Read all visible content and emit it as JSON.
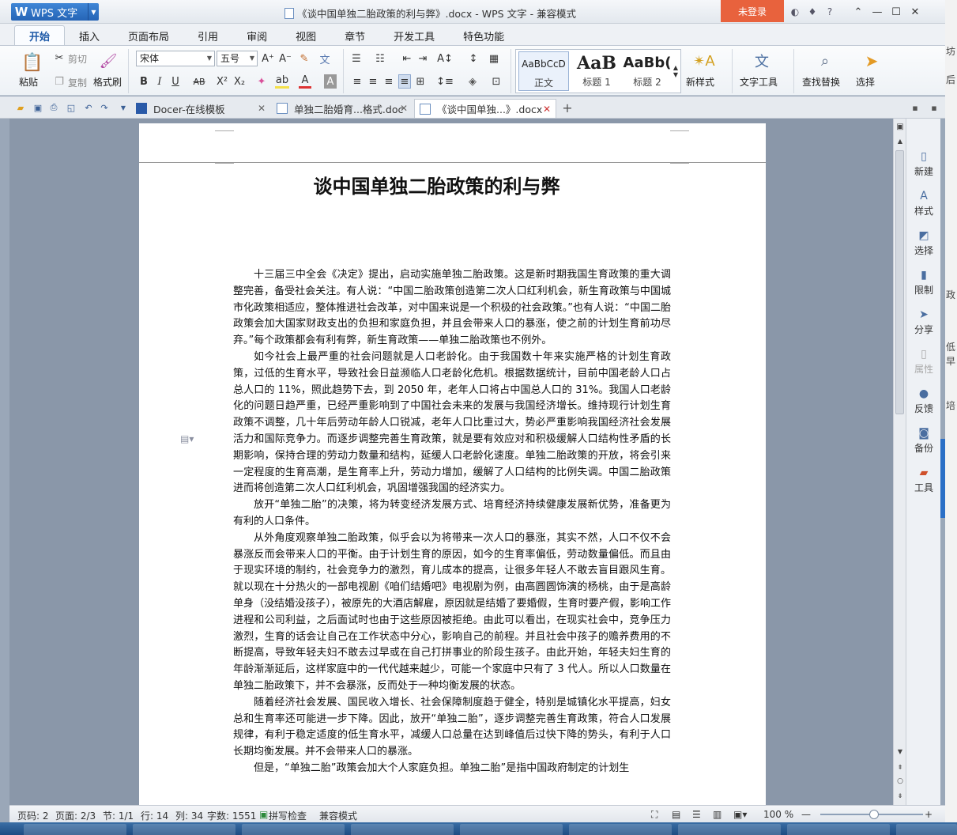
{
  "app": {
    "name": "WPS 文字"
  },
  "window": {
    "title": "《谈中国单独二胎政策的利与弊》.docx - WPS 文字 - 兼容模式",
    "login_label": "未登录"
  },
  "ribbon_tabs": [
    "开始",
    "插入",
    "页面布局",
    "引用",
    "审阅",
    "视图",
    "章节",
    "开发工具",
    "特色功能"
  ],
  "ribbon": {
    "paste": "粘贴",
    "cut": "剪切",
    "copy": "复制",
    "format_painter": "格式刷",
    "font_name": "宋体",
    "font_size": "五号",
    "styles": [
      {
        "sample": "AaBbCcD",
        "name": "正文"
      },
      {
        "sample": "AaB",
        "name": "标题 1"
      },
      {
        "sample": "AaBb(",
        "name": "标题 2"
      }
    ],
    "new_style": "新样式",
    "text_tools": "文字工具",
    "find_replace": "查找替换",
    "select": "选择"
  },
  "doc_tabs": [
    {
      "label": "Docer-在线模板"
    },
    {
      "label": "单独二胎婚育...格式.doc"
    },
    {
      "label": "《谈中国单独...》.docx"
    }
  ],
  "document": {
    "title": "谈中国单独二胎政策的利与弊",
    "paragraphs": [
      "十三届三中全会《决定》提出，启动实施单独二胎政策。这是新时期我国生育政策的重大调整完善，备受社会关注。有人说：“中国二胎政策创造第二次人口红利机会，新生育政策与中国城市化政策相适应，整体推进社会改革，对中国来说是一个积极的社会政策。”也有人说：“中国二胎政策会加大国家财政支出的负担和家庭负担，并且会带来人口的暴涨，使之前的计划生育前功尽弃。”每个政策都会有利有弊，新生育政策——单独二胎政策也不例外。",
      "如今社会上最严重的社会问题就是人口老龄化。由于我国数十年来实施严格的计划生育政策，过低的生育水平，导致社会日益濒临人口老龄化危机。根据数据统计，目前中国老龄人口占总人口的 11%，照此趋势下去，到 2050 年，老年人口将占中国总人口的 31%。我国人口老龄化的问题日趋严重，已经严重影响到了中国社会未来的发展与我国经济增长。维持现行计划生育政策不调整，几十年后劳动年龄人口锐减，老年人口比重过大，势必严重影响我国经济社会发展活力和国际竞争力。而逐步调整完善生育政策，就是要有效应对和积极缓解人口结构性矛盾的长期影响，保持合理的劳动力数量和结构，延缓人口老龄化速度。单独二胎政策的开放，将会引来一定程度的生育高潮，是生育率上升，劳动力增加，缓解了人口结构的比例失调。中国二胎政策进而将创造第二次人口红利机会，巩固增强我国的经济实力。",
      "放开“单独二胎”的决策，将为转变经济发展方式、培育经济持续健康发展新优势，准备更为有利的人口条件。",
      "从外角度观察单独二胎政策，似乎会以为将带来一次人口的暴涨，其实不然，人口不仅不会暴涨反而会带来人口的平衡。由于计划生育的原因，如今的生育率偏低，劳动数量偏低。而且由于现实环境的制约，社会竞争力的激烈，育儿成本的提高，让很多年轻人不敢去盲目跟风生育。就以现在十分热火的一部电视剧《咱们结婚吧》电视剧为例，由高圆圆饰演的杨桃，由于是高龄单身（没结婚没孩子），被原先的大酒店解雇，原因就是结婚了要婚假，生育时要产假，影响工作进程和公司利益，之后面试时也由于这些原因被拒绝。由此可以看出，在现实社会中，竞争压力激烈，生育的话会让自己在工作状态中分心，影响自己的前程。并且社会中孩子的赡养费用的不断提高，导致年轻夫妇不敢去过早或在自己打拼事业的阶段生孩子。由此开始，年轻夫妇生育的年龄渐渐延后，这样家庭中的一代代越来越少，可能一个家庭中只有了 3 代人。所以人口数量在单独二胎政策下，并不会暴涨，反而处于一种均衡发展的状态。",
      "随着经济社会发展、国民收入增长、社会保障制度趋于健全，特别是城镇化水平提高，妇女总和生育率还可能进一步下降。因此，放开“单独二胎”，逐步调整完善生育政策，符合人口发展规律，有利于稳定适度的低生育水平，减缓人口总量在达到峰值后过快下降的势头，有利于人口长期均衡发展。并不会带来人口的暴涨。",
      "但是，“单独二胎”政策会加大个人家庭负担。单独二胎”是指中国政府制定的计划生"
    ]
  },
  "side_panel": [
    "新建",
    "样式",
    "选择",
    "限制",
    "分享",
    "属性",
    "反馈",
    "备份",
    "工具"
  ],
  "status": {
    "page_code": "页码: 2",
    "pages": "页面: 2/3",
    "section": "节: 1/1",
    "row": "行: 14",
    "col": "列: 34",
    "word_count": "字数: 1551",
    "spell_check": "拼写检查",
    "compat_mode": "兼容模式",
    "zoom": "100 %"
  },
  "bg_window_text": [
    "坊",
    "后",
    "政",
    "低",
    "早",
    "培"
  ],
  "colors": {
    "accent": "#2b6fc6",
    "login": "#e8623d",
    "workspace": "#8a97a9"
  }
}
